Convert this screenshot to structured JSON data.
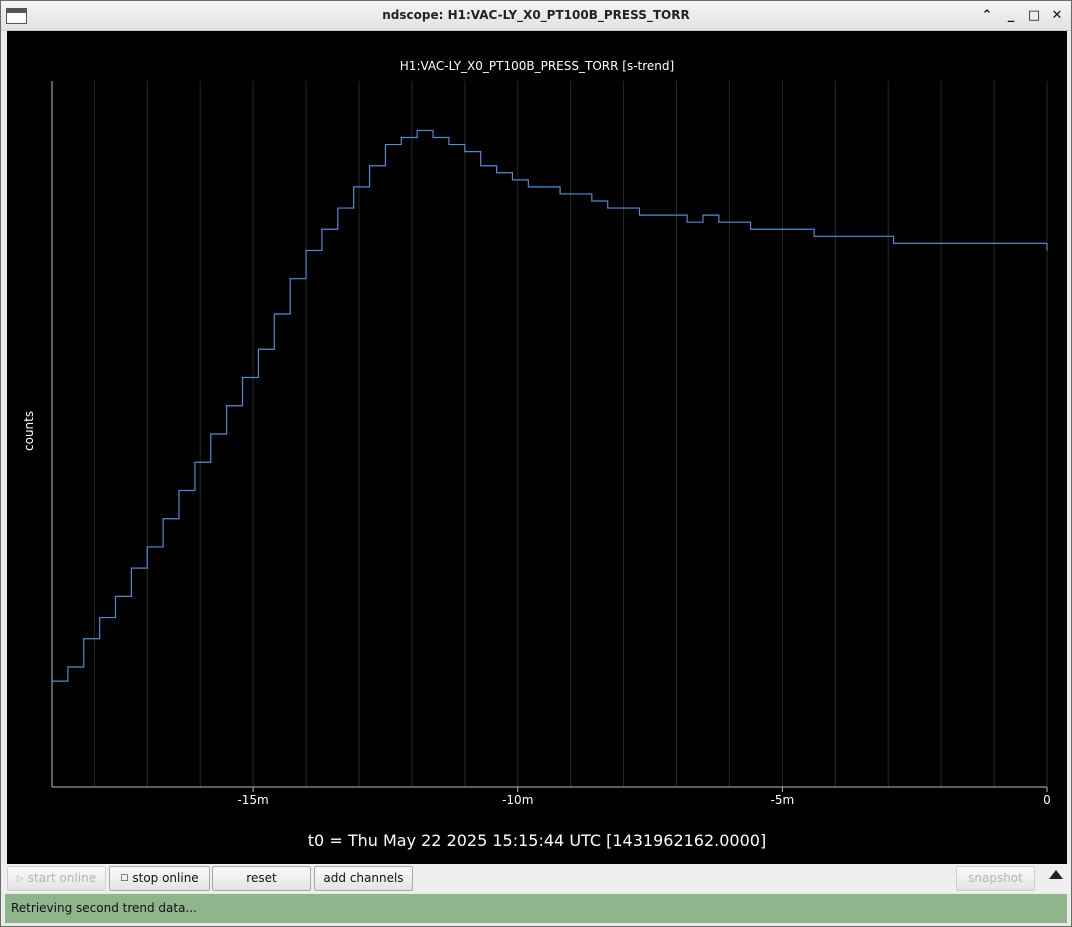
{
  "window": {
    "title": "ndscope: H1:VAC-LY_X0_PT100B_PRESS_TORR",
    "controls": {
      "shade": "⌃",
      "minimize": "_",
      "maximize": "□",
      "close": "✕"
    }
  },
  "plot": {
    "title": "H1:VAC-LY_X0_PT100B_PRESS_TORR [s-trend]",
    "ylabel": "counts",
    "t0_label": "t0 = Thu May 22 2025 15:15:44 UTC [1431962162.0000]"
  },
  "chart_data": {
    "type": "line",
    "title": "H1:VAC-LY_X0_PT100B_PRESS_TORR [s-trend]",
    "xlabel": "",
    "ylabel": "counts",
    "x_unit": "minutes relative to t0",
    "xlim": [
      -18.8,
      0
    ],
    "ylim": [
      0,
      100
    ],
    "xticks": [
      {
        "value": -15,
        "label": "-15m"
      },
      {
        "value": -10,
        "label": "-10m"
      },
      {
        "value": -5,
        "label": "-5m"
      },
      {
        "value": 0,
        "label": "0"
      }
    ],
    "grid": "vertical",
    "line_color": "#4a8fd6",
    "series": [
      {
        "x": [
          -18.8,
          -18.5,
          -18.2,
          -17.9,
          -17.6,
          -17.3,
          -17.0,
          -16.7,
          -16.4,
          -16.1,
          -15.8,
          -15.5,
          -15.2,
          -14.9,
          -14.6,
          -14.3,
          -14.0,
          -13.7,
          -13.4,
          -13.1,
          -12.8,
          -12.5,
          -12.2,
          -11.9,
          -11.6,
          -11.3,
          -11.0,
          -10.7,
          -10.4,
          -10.1,
          -9.8,
          -9.5,
          -9.2,
          -8.9,
          -8.6,
          -8.3,
          -8.0,
          -7.7,
          -7.4,
          -7.1,
          -6.8,
          -6.5,
          -6.2,
          -5.9,
          -5.6,
          -5.3,
          -5.0,
          -4.7,
          -4.4,
          -4.1,
          -3.8,
          -3.5,
          -3.2,
          -2.9,
          -2.6,
          -2.3,
          -2.0,
          -1.7,
          -1.4,
          -1.1,
          -0.8,
          -0.5,
          -0.2,
          0.0
        ],
        "y": [
          15,
          17,
          21,
          24,
          27,
          31,
          34,
          38,
          42,
          46,
          50,
          54,
          58,
          62,
          67,
          72,
          76,
          79,
          82,
          85,
          88,
          91,
          92,
          93,
          92,
          91,
          90,
          88,
          87,
          86,
          85,
          85,
          84,
          84,
          83,
          82,
          82,
          81,
          81,
          81,
          80,
          81,
          80,
          80,
          79,
          79,
          79,
          79,
          78,
          78,
          78,
          78,
          78,
          77,
          77,
          77,
          77,
          77,
          77,
          77,
          77,
          77,
          77,
          76
        ]
      }
    ]
  },
  "toolbar": {
    "start_online": "start online",
    "stop_online": "stop online",
    "reset": "reset",
    "add_channels": "add channels",
    "snapshot": "snapshot"
  },
  "status": {
    "text": "Retrieving second trend data..."
  }
}
